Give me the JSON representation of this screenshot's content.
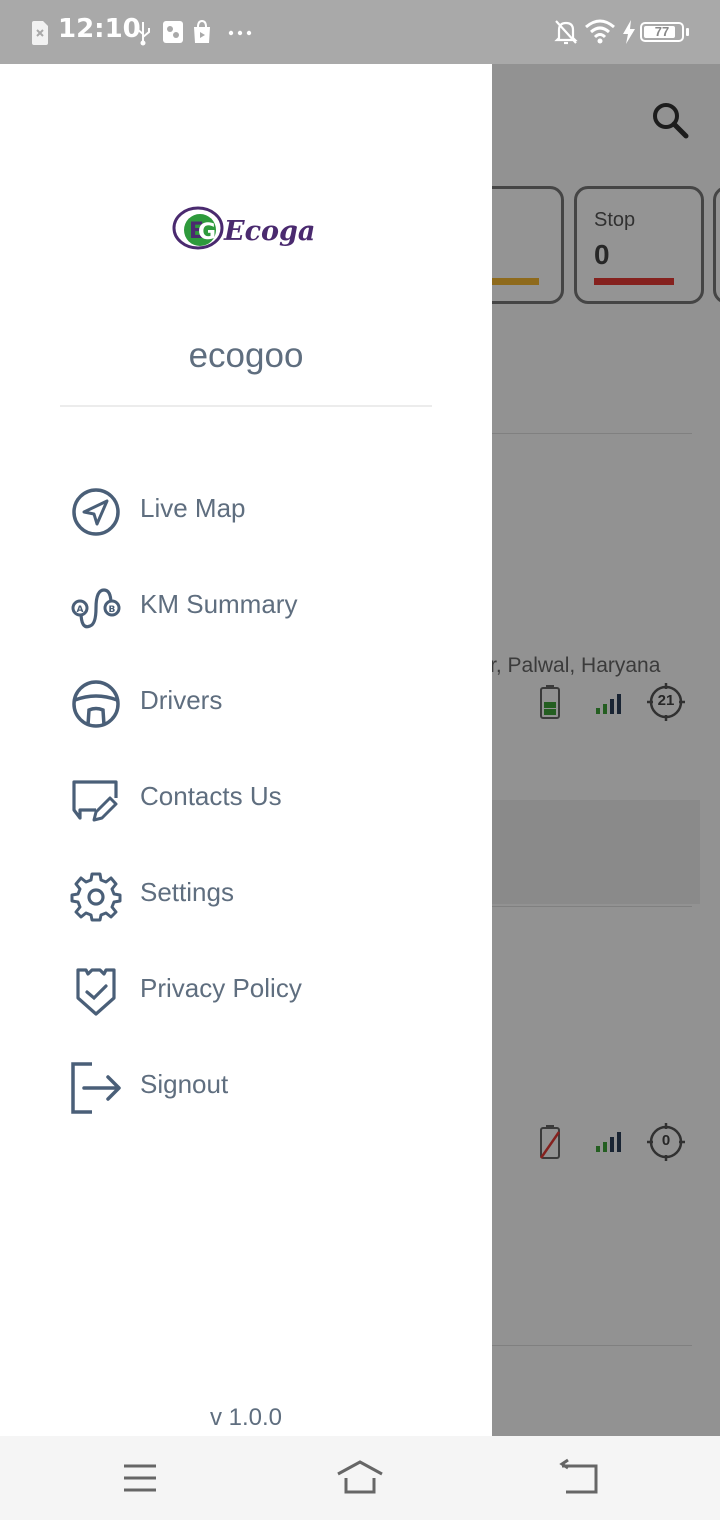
{
  "status_bar": {
    "time": "12:10",
    "battery_level": "77",
    "icons": [
      "sim-icon",
      "usb-icon",
      "app-icon",
      "store-icon",
      "more-icon",
      "silent-icon",
      "wifi-icon",
      "charging-icon",
      "battery-icon"
    ]
  },
  "background": {
    "card_stop_label": "Stop",
    "card_stop_value": "0",
    "address_text": "r, Palwal, Haryana",
    "badge_1": "21",
    "badge_2": "0",
    "colors": {
      "idle_bar": "#f5b731",
      "stop_bar": "#e53935"
    }
  },
  "drawer": {
    "brand": "Ecogas",
    "username": "ecogoo",
    "menu": [
      {
        "label": "Live Map",
        "icon": "navigation-arrow-icon"
      },
      {
        "label": "KM Summary",
        "icon": "route-ab-icon"
      },
      {
        "label": "Drivers",
        "icon": "steering-wheel-icon"
      },
      {
        "label": "Contacts Us",
        "icon": "chat-edit-icon"
      },
      {
        "label": "Settings",
        "icon": "gear-icon"
      },
      {
        "label": "Privacy Policy",
        "icon": "shield-check-icon"
      },
      {
        "label": "Signout",
        "icon": "signout-icon"
      }
    ],
    "version": "v 1.0.0",
    "colors": {
      "text": "#5f6e7f",
      "icon": "#4a5f78",
      "logo_green": "#2e9a3c",
      "logo_purple": "#4a2a6f"
    }
  },
  "nav_bar": {
    "buttons": [
      "menu-icon",
      "home-icon",
      "back-icon"
    ]
  }
}
